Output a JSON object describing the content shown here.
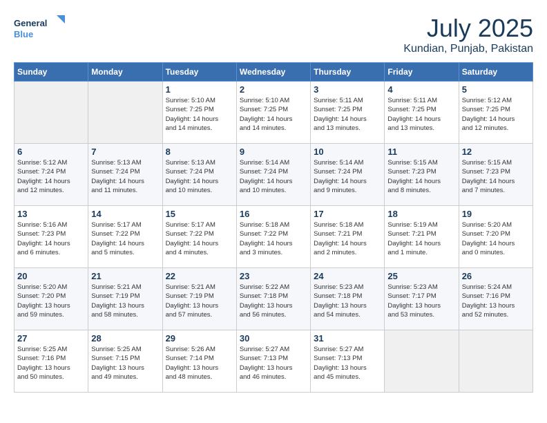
{
  "header": {
    "logo_line1": "General",
    "logo_line2": "Blue",
    "month": "July 2025",
    "location": "Kundian, Punjab, Pakistan"
  },
  "weekdays": [
    "Sunday",
    "Monday",
    "Tuesday",
    "Wednesday",
    "Thursday",
    "Friday",
    "Saturday"
  ],
  "weeks": [
    [
      {
        "day": "",
        "info": ""
      },
      {
        "day": "",
        "info": ""
      },
      {
        "day": "1",
        "info": "Sunrise: 5:10 AM\nSunset: 7:25 PM\nDaylight: 14 hours\nand 14 minutes."
      },
      {
        "day": "2",
        "info": "Sunrise: 5:10 AM\nSunset: 7:25 PM\nDaylight: 14 hours\nand 14 minutes."
      },
      {
        "day": "3",
        "info": "Sunrise: 5:11 AM\nSunset: 7:25 PM\nDaylight: 14 hours\nand 13 minutes."
      },
      {
        "day": "4",
        "info": "Sunrise: 5:11 AM\nSunset: 7:25 PM\nDaylight: 14 hours\nand 13 minutes."
      },
      {
        "day": "5",
        "info": "Sunrise: 5:12 AM\nSunset: 7:25 PM\nDaylight: 14 hours\nand 12 minutes."
      }
    ],
    [
      {
        "day": "6",
        "info": "Sunrise: 5:12 AM\nSunset: 7:24 PM\nDaylight: 14 hours\nand 12 minutes."
      },
      {
        "day": "7",
        "info": "Sunrise: 5:13 AM\nSunset: 7:24 PM\nDaylight: 14 hours\nand 11 minutes."
      },
      {
        "day": "8",
        "info": "Sunrise: 5:13 AM\nSunset: 7:24 PM\nDaylight: 14 hours\nand 10 minutes."
      },
      {
        "day": "9",
        "info": "Sunrise: 5:14 AM\nSunset: 7:24 PM\nDaylight: 14 hours\nand 10 minutes."
      },
      {
        "day": "10",
        "info": "Sunrise: 5:14 AM\nSunset: 7:24 PM\nDaylight: 14 hours\nand 9 minutes."
      },
      {
        "day": "11",
        "info": "Sunrise: 5:15 AM\nSunset: 7:23 PM\nDaylight: 14 hours\nand 8 minutes."
      },
      {
        "day": "12",
        "info": "Sunrise: 5:15 AM\nSunset: 7:23 PM\nDaylight: 14 hours\nand 7 minutes."
      }
    ],
    [
      {
        "day": "13",
        "info": "Sunrise: 5:16 AM\nSunset: 7:23 PM\nDaylight: 14 hours\nand 6 minutes."
      },
      {
        "day": "14",
        "info": "Sunrise: 5:17 AM\nSunset: 7:22 PM\nDaylight: 14 hours\nand 5 minutes."
      },
      {
        "day": "15",
        "info": "Sunrise: 5:17 AM\nSunset: 7:22 PM\nDaylight: 14 hours\nand 4 minutes."
      },
      {
        "day": "16",
        "info": "Sunrise: 5:18 AM\nSunset: 7:22 PM\nDaylight: 14 hours\nand 3 minutes."
      },
      {
        "day": "17",
        "info": "Sunrise: 5:18 AM\nSunset: 7:21 PM\nDaylight: 14 hours\nand 2 minutes."
      },
      {
        "day": "18",
        "info": "Sunrise: 5:19 AM\nSunset: 7:21 PM\nDaylight: 14 hours\nand 1 minute."
      },
      {
        "day": "19",
        "info": "Sunrise: 5:20 AM\nSunset: 7:20 PM\nDaylight: 14 hours\nand 0 minutes."
      }
    ],
    [
      {
        "day": "20",
        "info": "Sunrise: 5:20 AM\nSunset: 7:20 PM\nDaylight: 13 hours\nand 59 minutes."
      },
      {
        "day": "21",
        "info": "Sunrise: 5:21 AM\nSunset: 7:19 PM\nDaylight: 13 hours\nand 58 minutes."
      },
      {
        "day": "22",
        "info": "Sunrise: 5:21 AM\nSunset: 7:19 PM\nDaylight: 13 hours\nand 57 minutes."
      },
      {
        "day": "23",
        "info": "Sunrise: 5:22 AM\nSunset: 7:18 PM\nDaylight: 13 hours\nand 56 minutes."
      },
      {
        "day": "24",
        "info": "Sunrise: 5:23 AM\nSunset: 7:18 PM\nDaylight: 13 hours\nand 54 minutes."
      },
      {
        "day": "25",
        "info": "Sunrise: 5:23 AM\nSunset: 7:17 PM\nDaylight: 13 hours\nand 53 minutes."
      },
      {
        "day": "26",
        "info": "Sunrise: 5:24 AM\nSunset: 7:16 PM\nDaylight: 13 hours\nand 52 minutes."
      }
    ],
    [
      {
        "day": "27",
        "info": "Sunrise: 5:25 AM\nSunset: 7:16 PM\nDaylight: 13 hours\nand 50 minutes."
      },
      {
        "day": "28",
        "info": "Sunrise: 5:25 AM\nSunset: 7:15 PM\nDaylight: 13 hours\nand 49 minutes."
      },
      {
        "day": "29",
        "info": "Sunrise: 5:26 AM\nSunset: 7:14 PM\nDaylight: 13 hours\nand 48 minutes."
      },
      {
        "day": "30",
        "info": "Sunrise: 5:27 AM\nSunset: 7:13 PM\nDaylight: 13 hours\nand 46 minutes."
      },
      {
        "day": "31",
        "info": "Sunrise: 5:27 AM\nSunset: 7:13 PM\nDaylight: 13 hours\nand 45 minutes."
      },
      {
        "day": "",
        "info": ""
      },
      {
        "day": "",
        "info": ""
      }
    ]
  ]
}
